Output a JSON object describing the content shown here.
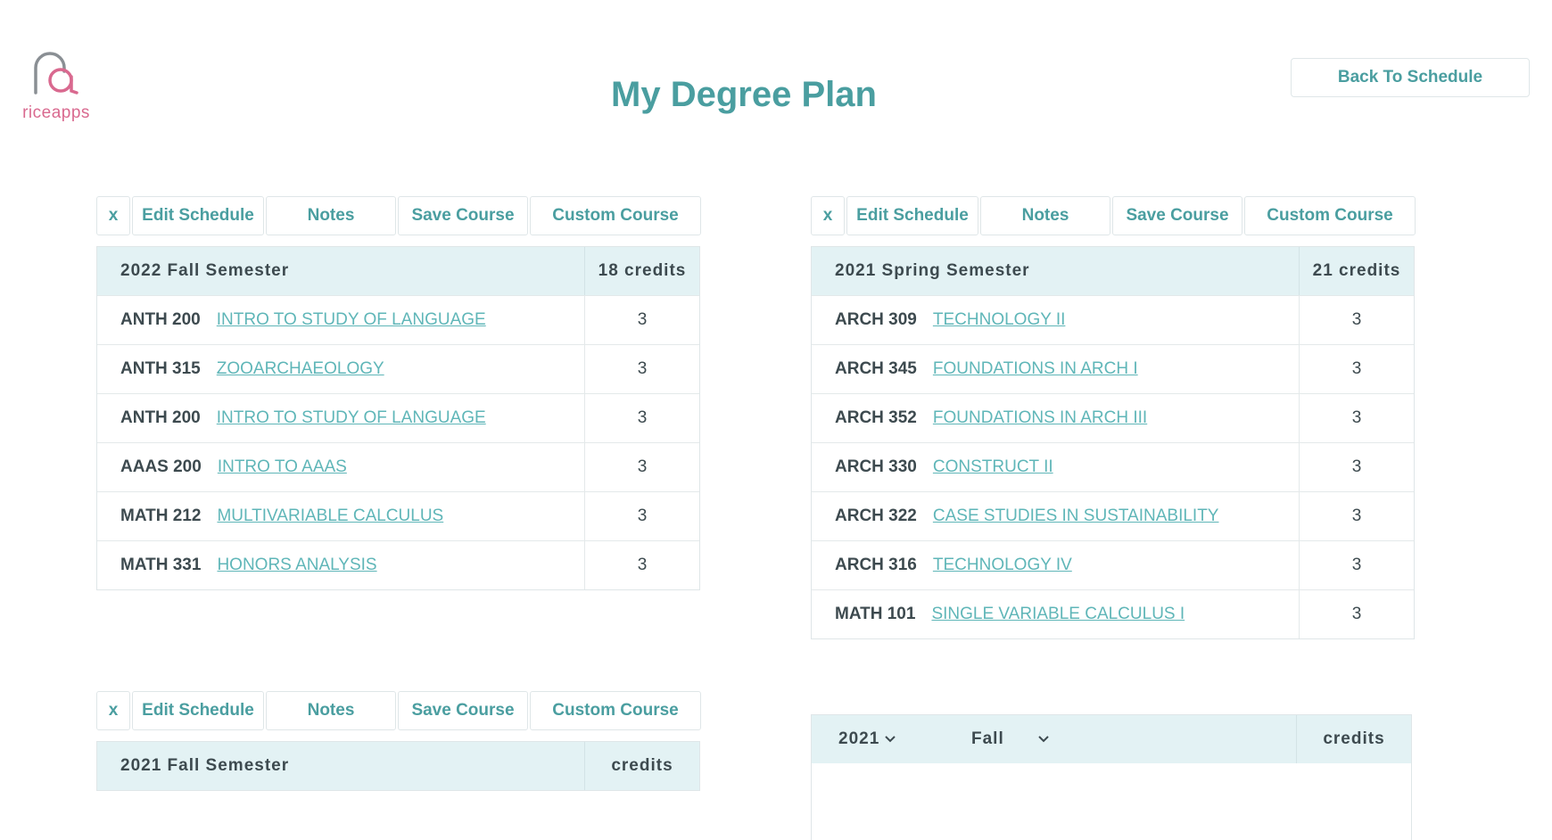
{
  "logo": {
    "text": "riceapps"
  },
  "header": {
    "title": "My Degree Plan",
    "back_label": "Back To Schedule"
  },
  "toolbar": {
    "close_label": "x",
    "edit_label": "Edit Schedule",
    "notes_label": "Notes",
    "save_label": "Save Course",
    "custom_label": "Custom Course"
  },
  "semesters": [
    {
      "name": "2022 Fall Semester",
      "credits": "18 credits",
      "courses": [
        {
          "code": "ANTH 200",
          "title": "INTRO TO STUDY OF LANGUAGE",
          "credits": "3"
        },
        {
          "code": "ANTH 315",
          "title": "ZOOARCHAEOLOGY",
          "credits": "3"
        },
        {
          "code": "ANTH 200",
          "title": "INTRO TO STUDY OF LANGUAGE",
          "credits": "3"
        },
        {
          "code": "AAAS 200",
          "title": "INTRO TO AAAS",
          "credits": "3"
        },
        {
          "code": "MATH 212",
          "title": "MULTIVARIABLE CALCULUS",
          "credits": "3"
        },
        {
          "code": "MATH 331",
          "title": "HONORS ANALYSIS",
          "credits": "3"
        }
      ]
    },
    {
      "name": "2021 Spring Semester",
      "credits": "21 credits",
      "courses": [
        {
          "code": "ARCH 309",
          "title": "TECHNOLOGY II",
          "credits": "3"
        },
        {
          "code": "ARCH 345",
          "title": "FOUNDATIONS IN ARCH I",
          "credits": "3"
        },
        {
          "code": "ARCH 352",
          "title": "FOUNDATIONS IN ARCH III",
          "credits": "3"
        },
        {
          "code": "ARCH 330",
          "title": "CONSTRUCT II",
          "credits": "3"
        },
        {
          "code": "ARCH 322",
          "title": "CASE STUDIES IN SUSTAINABILITY",
          "credits": "3"
        },
        {
          "code": "ARCH 316",
          "title": "TECHNOLOGY IV",
          "credits": "3"
        },
        {
          "code": "MATH 101",
          "title": "SINGLE VARIABLE CALCULUS I",
          "credits": "3"
        }
      ]
    },
    {
      "name": "2021 Fall Semester",
      "credits": "credits",
      "courses": []
    }
  ],
  "new_semester": {
    "year_value": "2021",
    "term_value": "Fall",
    "credits_label": "credits"
  },
  "colors": {
    "accent": "#4a9ea0",
    "link": "#5fb6b8",
    "header_bg": "#e3f2f4",
    "logo": "#d9698f"
  }
}
